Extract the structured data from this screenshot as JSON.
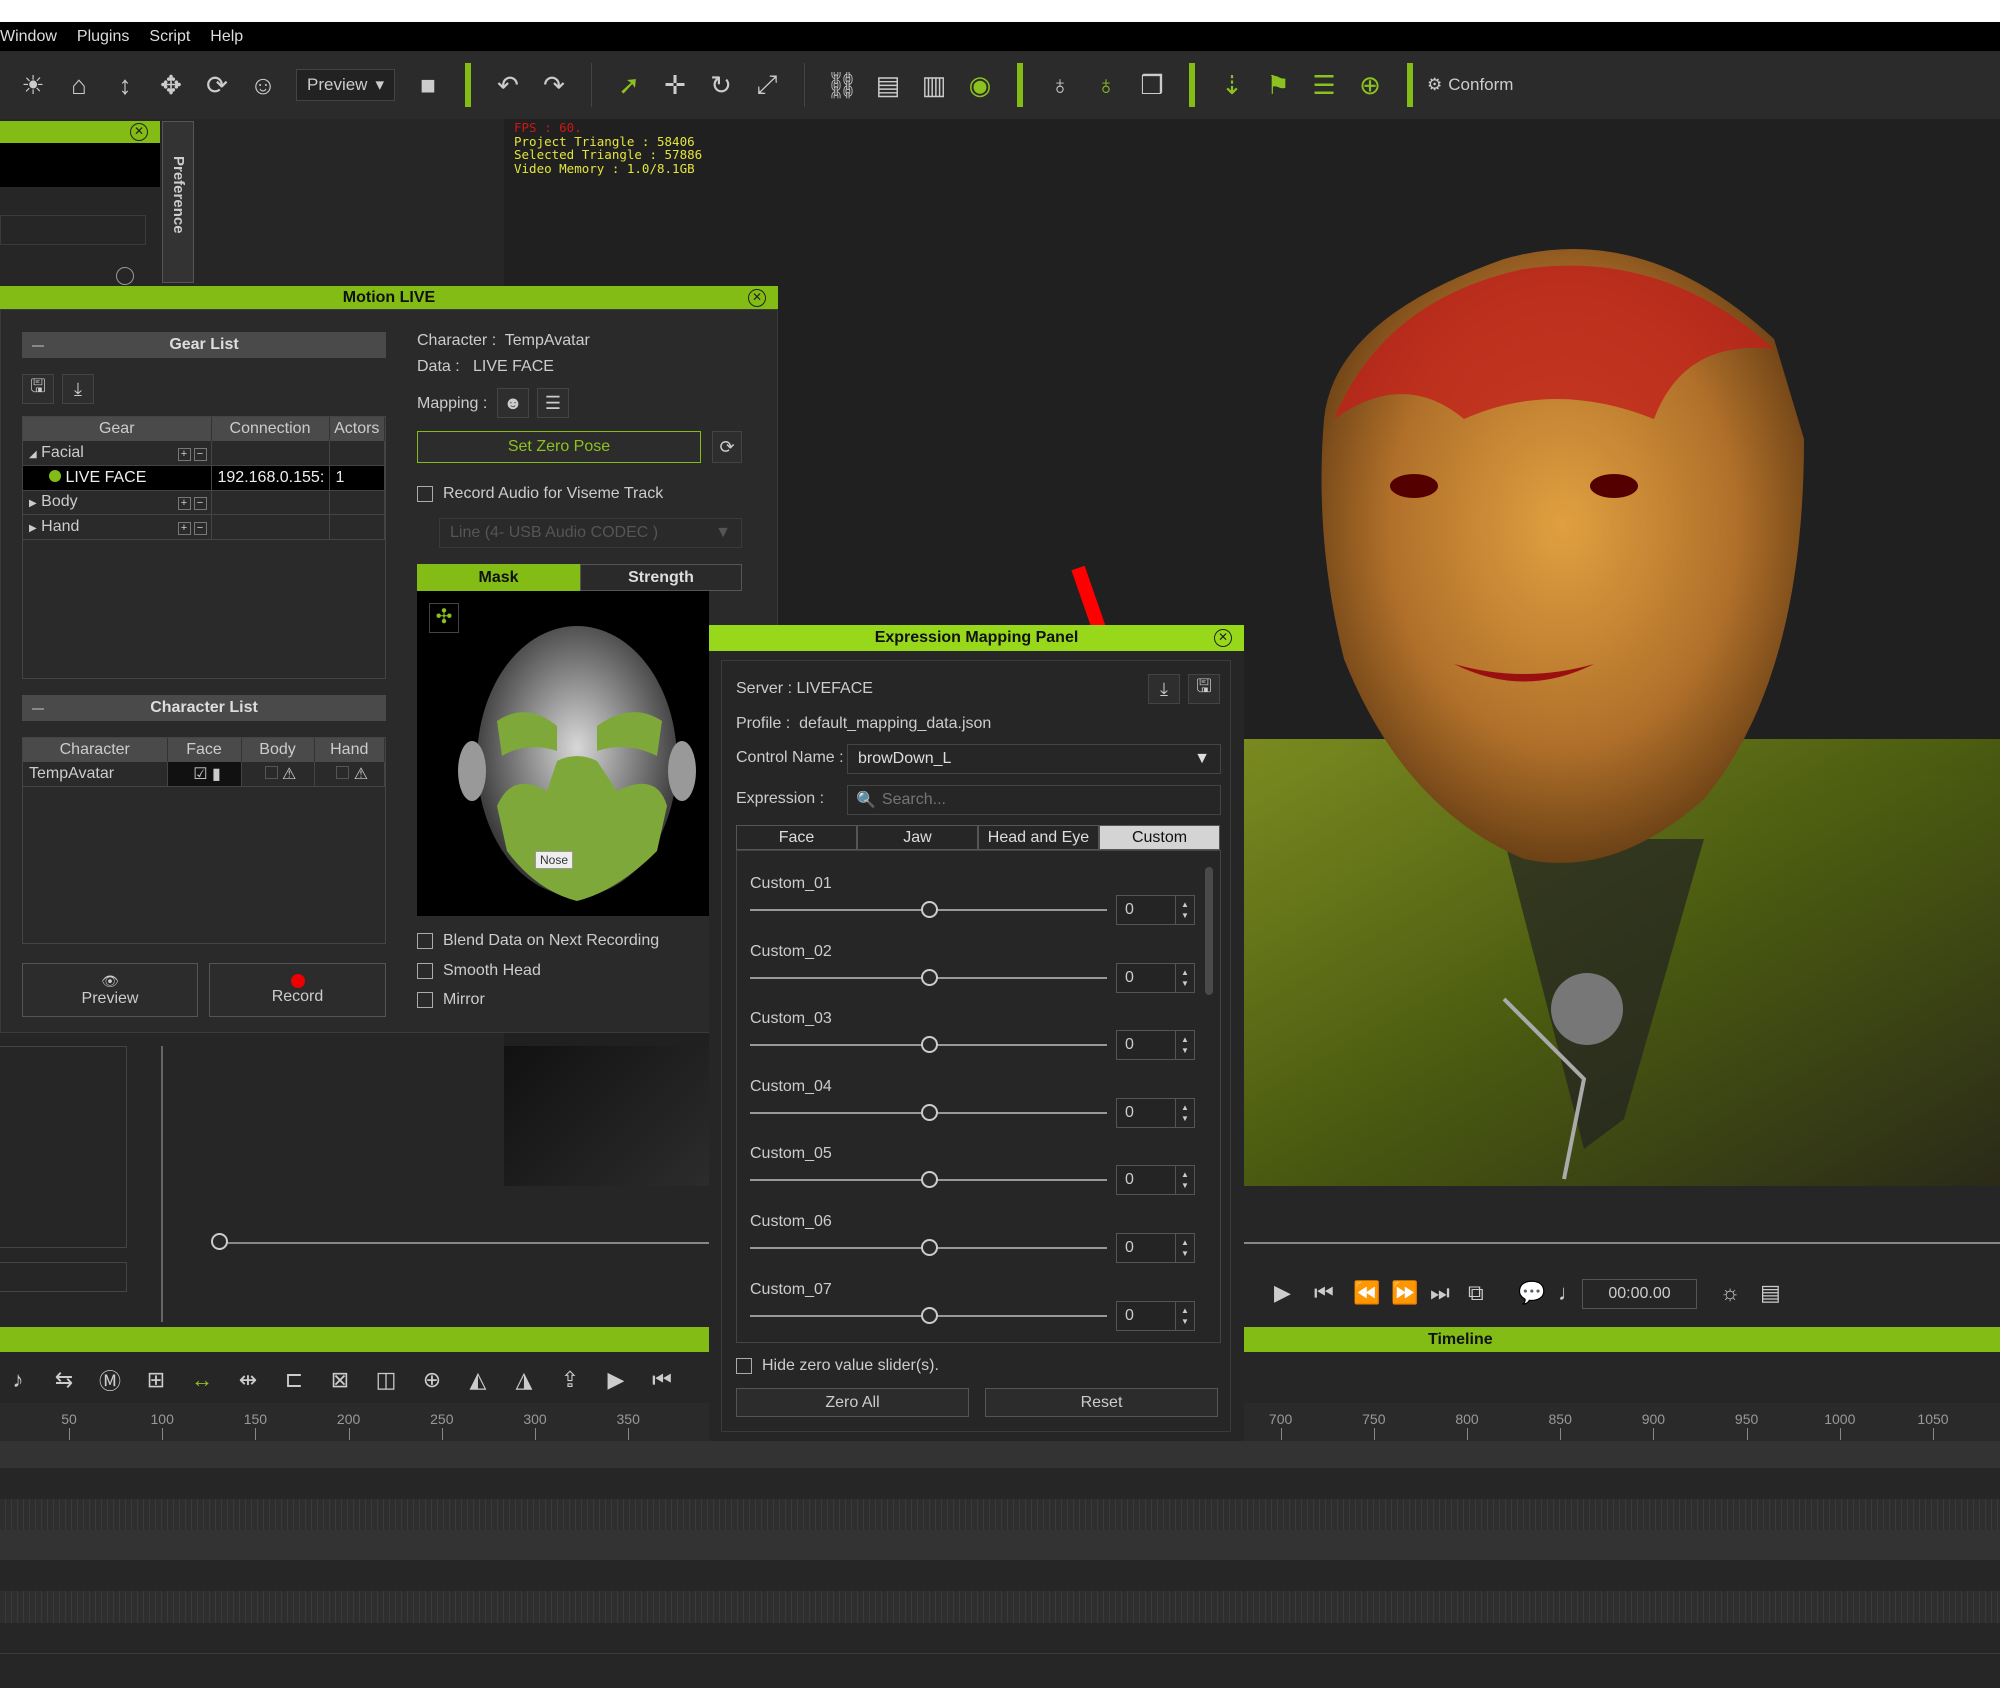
{
  "menu": [
    "Window",
    "Plugins",
    "Script",
    "Help"
  ],
  "toolbar": {
    "preview_label": "Preview",
    "conform_label": "Conform",
    "icons_a": [
      [
        "sun-icon",
        "☀"
      ],
      [
        "home-icon",
        "⌂"
      ],
      [
        "fit-vertical-icon",
        "↕"
      ],
      [
        "fit-all-icon",
        "✥"
      ],
      [
        "orbit-icon",
        "⟳"
      ],
      [
        "face-icon",
        "☺"
      ]
    ],
    "icons_b": [
      [
        "undo-icon",
        "↶"
      ],
      [
        "redo-icon",
        "↷"
      ]
    ],
    "icons_c": [
      [
        "select-arrow-icon",
        "➚"
      ],
      [
        "move-icon",
        "✛"
      ],
      [
        "rotate-icon",
        "↻"
      ],
      [
        "scale-icon",
        "⤢"
      ]
    ],
    "icons_d": [
      [
        "link-icon",
        "⛓"
      ],
      [
        "align-left-icon",
        "▤"
      ],
      [
        "align-right-icon",
        "▥"
      ],
      [
        "eye-icon",
        "◉"
      ]
    ],
    "icons_e": [
      [
        "pose-icon",
        "♁"
      ],
      [
        "pose-visible-icon",
        "♁"
      ],
      [
        "cubes-icon",
        "❒"
      ]
    ],
    "icons_f": [
      [
        "drop-to-floor-icon",
        "⇣"
      ],
      [
        "flag-icon",
        "⚑"
      ],
      [
        "list-settings-icon",
        "☰"
      ],
      [
        "add-node-icon",
        "⊕"
      ]
    ]
  },
  "stats": {
    "fps": "FPS : 60.",
    "project_triangle": "Project Triangle : 58406",
    "selected_triangle": "Selected Triangle : 57886",
    "video_memory": "Video Memory : 1.0/8.1GB"
  },
  "preference_tab": "Preference",
  "motion_live": {
    "title": "Motion LIVE",
    "gear_list": {
      "title": "Gear List",
      "columns": [
        "Gear",
        "Connection",
        "Actors"
      ],
      "rows": [
        {
          "gear": "Facial",
          "connection": "",
          "actors": ""
        },
        {
          "gear": "LIVE FACE",
          "connection": "192.168.0.155:",
          "actors": "1"
        },
        {
          "gear": "Body",
          "connection": "",
          "actors": ""
        },
        {
          "gear": "Hand",
          "connection": "",
          "actors": ""
        }
      ]
    },
    "character_list": {
      "title": "Character List",
      "columns": [
        "Character",
        "Face",
        "Body",
        "Hand"
      ],
      "rows": [
        {
          "character": "TempAvatar"
        }
      ]
    },
    "preview_label": "Preview",
    "record_label": "Record",
    "character_label": "Character :",
    "character_value": "TempAvatar",
    "data_label": "Data :",
    "data_value": "LIVE FACE",
    "mapping_label": "Mapping :",
    "set_zero_pose": "Set Zero Pose",
    "record_audio_label": "Record Audio for Viseme Track",
    "record_audio_checked": false,
    "audio_device": "Line (4- USB Audio CODEC )",
    "tabs": [
      "Mask",
      "Strength"
    ],
    "active_tab": "Mask",
    "mask_tooltip": "Nose",
    "options": [
      {
        "label": "Blend Data on Next Recording",
        "checked": false
      },
      {
        "label": "Smooth Head",
        "checked": false
      },
      {
        "label": "Mirror",
        "checked": false
      }
    ]
  },
  "expression_panel": {
    "title": "Expression Mapping Panel",
    "server": "Server : LIVEFACE",
    "profile_label": "Profile :",
    "profile_value": "default_mapping_data.json",
    "control_name_label": "Control Name :",
    "control_name_value": "browDown_L",
    "expression_label": "Expression :",
    "search_placeholder": "Search...",
    "tabs": [
      "Face",
      "Jaw",
      "Head and Eye",
      "Custom"
    ],
    "active_tab": "Custom",
    "sliders": [
      {
        "name": "Custom_01",
        "value": 0
      },
      {
        "name": "Custom_02",
        "value": 0
      },
      {
        "name": "Custom_03",
        "value": 0
      },
      {
        "name": "Custom_04",
        "value": 0
      },
      {
        "name": "Custom_05",
        "value": 0
      },
      {
        "name": "Custom_06",
        "value": 0
      },
      {
        "name": "Custom_07",
        "value": 0
      }
    ],
    "hide_zero_label": "Hide zero value slider(s).",
    "hide_zero_checked": false,
    "zero_all": "Zero All",
    "reset": "Reset"
  },
  "playback": {
    "time": "00:00.00"
  },
  "timeline": {
    "title": "Timeline",
    "ruler_left": [
      50,
      100,
      150,
      200,
      250,
      300,
      350
    ],
    "ruler_right": [
      700,
      750,
      800,
      850,
      900,
      950,
      1000,
      1050
    ]
  },
  "colors": {
    "accent": "#82bc14",
    "annotation_arrow": "#ff0000"
  }
}
